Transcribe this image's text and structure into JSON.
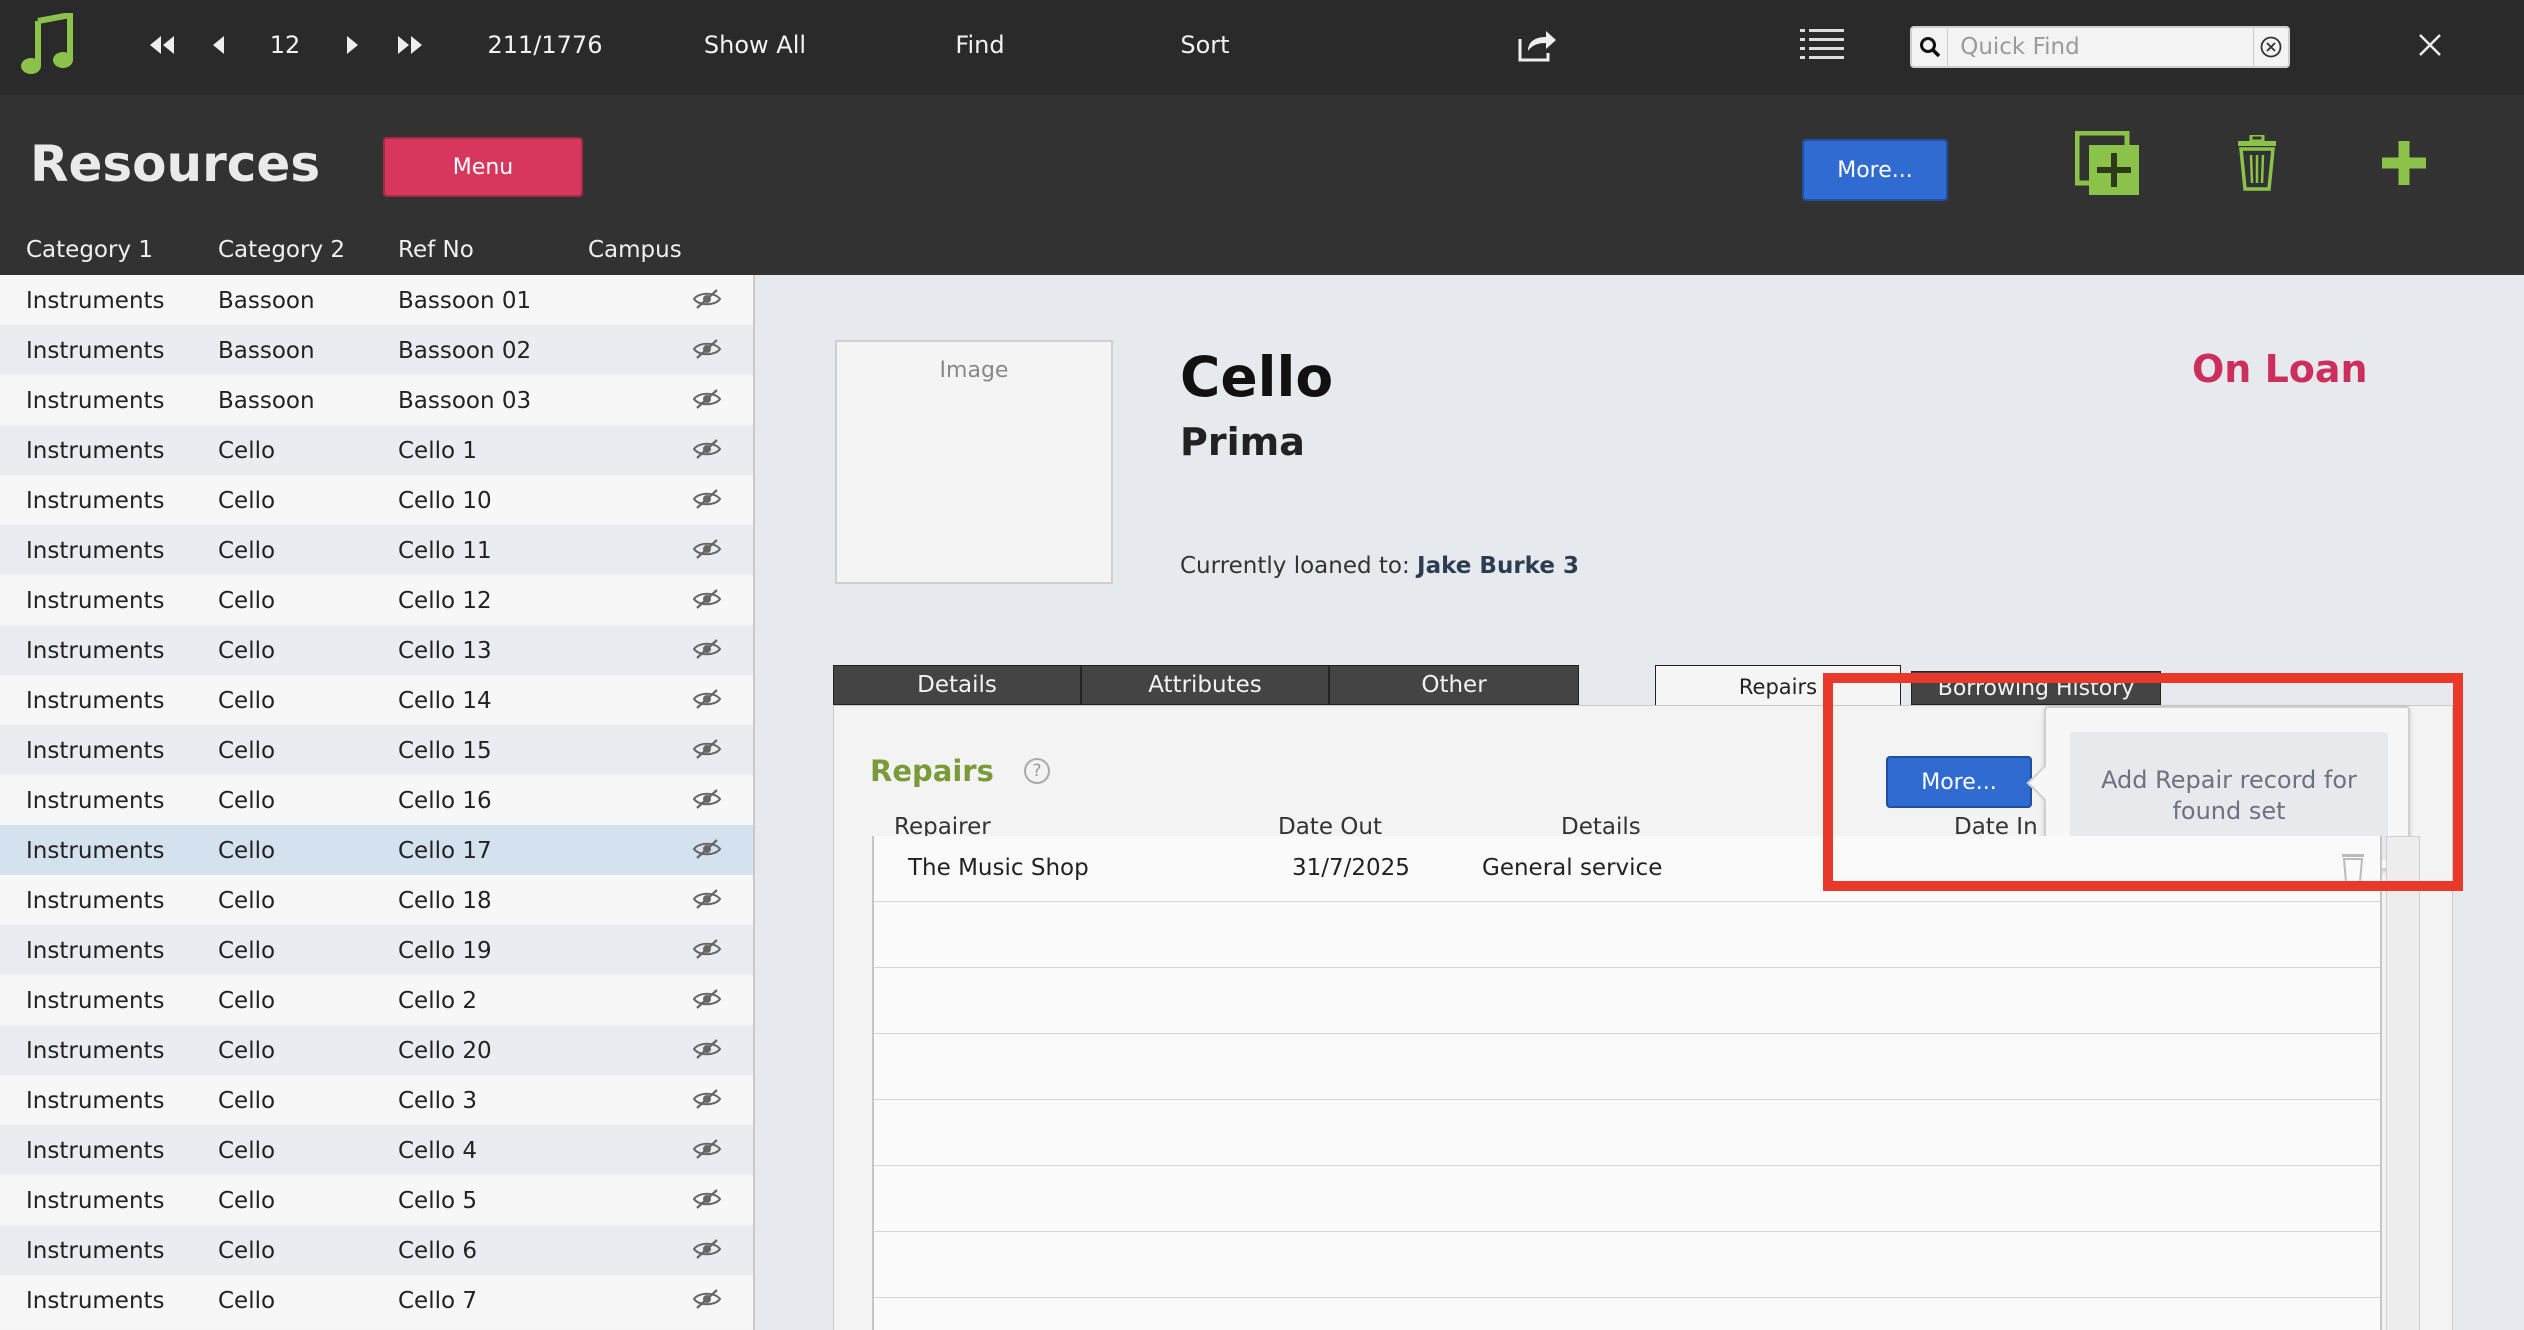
{
  "toolbar": {
    "record_number": "12",
    "record_count": "211/1776",
    "show_all": "Show All",
    "find": "Find",
    "sort": "Sort",
    "quick_find_placeholder": "Quick Find",
    "icons": [
      "music-note-icon",
      "first-record-icon",
      "previous-record-icon",
      "next-record-icon",
      "last-record-icon",
      "share-icon",
      "list-view-icon",
      "search-icon",
      "clear-icon",
      "close-icon"
    ]
  },
  "header": {
    "title": "Resources",
    "menu_label": "Menu",
    "more_label": "More...",
    "colors": {
      "menu": "#d8375d",
      "more": "#2f6bd1",
      "action_green": "#8bc34a"
    }
  },
  "list": {
    "columns": [
      "Category 1",
      "Category 2",
      "Ref No",
      "Campus"
    ],
    "rows": [
      {
        "cat1": "Instruments",
        "cat2": "Bassoon",
        "ref": "Bassoon 01"
      },
      {
        "cat1": "Instruments",
        "cat2": "Bassoon",
        "ref": "Bassoon 02"
      },
      {
        "cat1": "Instruments",
        "cat2": "Bassoon",
        "ref": "Bassoon 03"
      },
      {
        "cat1": "Instruments",
        "cat2": "Cello",
        "ref": "Cello 1"
      },
      {
        "cat1": "Instruments",
        "cat2": "Cello",
        "ref": "Cello 10"
      },
      {
        "cat1": "Instruments",
        "cat2": "Cello",
        "ref": "Cello 11"
      },
      {
        "cat1": "Instruments",
        "cat2": "Cello",
        "ref": "Cello 12"
      },
      {
        "cat1": "Instruments",
        "cat2": "Cello",
        "ref": "Cello 13"
      },
      {
        "cat1": "Instruments",
        "cat2": "Cello",
        "ref": "Cello 14"
      },
      {
        "cat1": "Instruments",
        "cat2": "Cello",
        "ref": "Cello 15"
      },
      {
        "cat1": "Instruments",
        "cat2": "Cello",
        "ref": "Cello 16"
      },
      {
        "cat1": "Instruments",
        "cat2": "Cello",
        "ref": "Cello 17",
        "selected": true
      },
      {
        "cat1": "Instruments",
        "cat2": "Cello",
        "ref": "Cello 18"
      },
      {
        "cat1": "Instruments",
        "cat2": "Cello",
        "ref": "Cello 19"
      },
      {
        "cat1": "Instruments",
        "cat2": "Cello",
        "ref": "Cello 2"
      },
      {
        "cat1": "Instruments",
        "cat2": "Cello",
        "ref": "Cello 20"
      },
      {
        "cat1": "Instruments",
        "cat2": "Cello",
        "ref": "Cello 3"
      },
      {
        "cat1": "Instruments",
        "cat2": "Cello",
        "ref": "Cello 4"
      },
      {
        "cat1": "Instruments",
        "cat2": "Cello",
        "ref": "Cello 5"
      },
      {
        "cat1": "Instruments",
        "cat2": "Cello",
        "ref": "Cello 6"
      },
      {
        "cat1": "Instruments",
        "cat2": "Cello",
        "ref": "Cello 7"
      }
    ]
  },
  "detail": {
    "image_label": "Image",
    "title": "Cello",
    "subtitle": "Prima",
    "status": "On Loan",
    "loaned_label": "Currently loaned to:",
    "loaned_to": "Jake Burke 3",
    "status_color": "#cc2f5a"
  },
  "tabs": {
    "details": "Details",
    "attributes": "Attributes",
    "other": "Other",
    "repairs": "Repairs",
    "borrowing": "Borrowing History",
    "active": "repairs"
  },
  "repairs": {
    "section_title": "Repairs",
    "more_label": "More...",
    "popover_item": "Add Repair record for found set",
    "columns": {
      "repairer": "Repairer",
      "date_out": "Date Out",
      "details": "Details",
      "date_in": "Date In"
    },
    "rows": [
      {
        "repairer": "The Music Shop",
        "date_out": "31/7/2025",
        "details": "General service",
        "date_in": ""
      }
    ],
    "section_color": "#7a9b3a"
  },
  "annotation": {
    "highlight_color": "#e8392b"
  }
}
